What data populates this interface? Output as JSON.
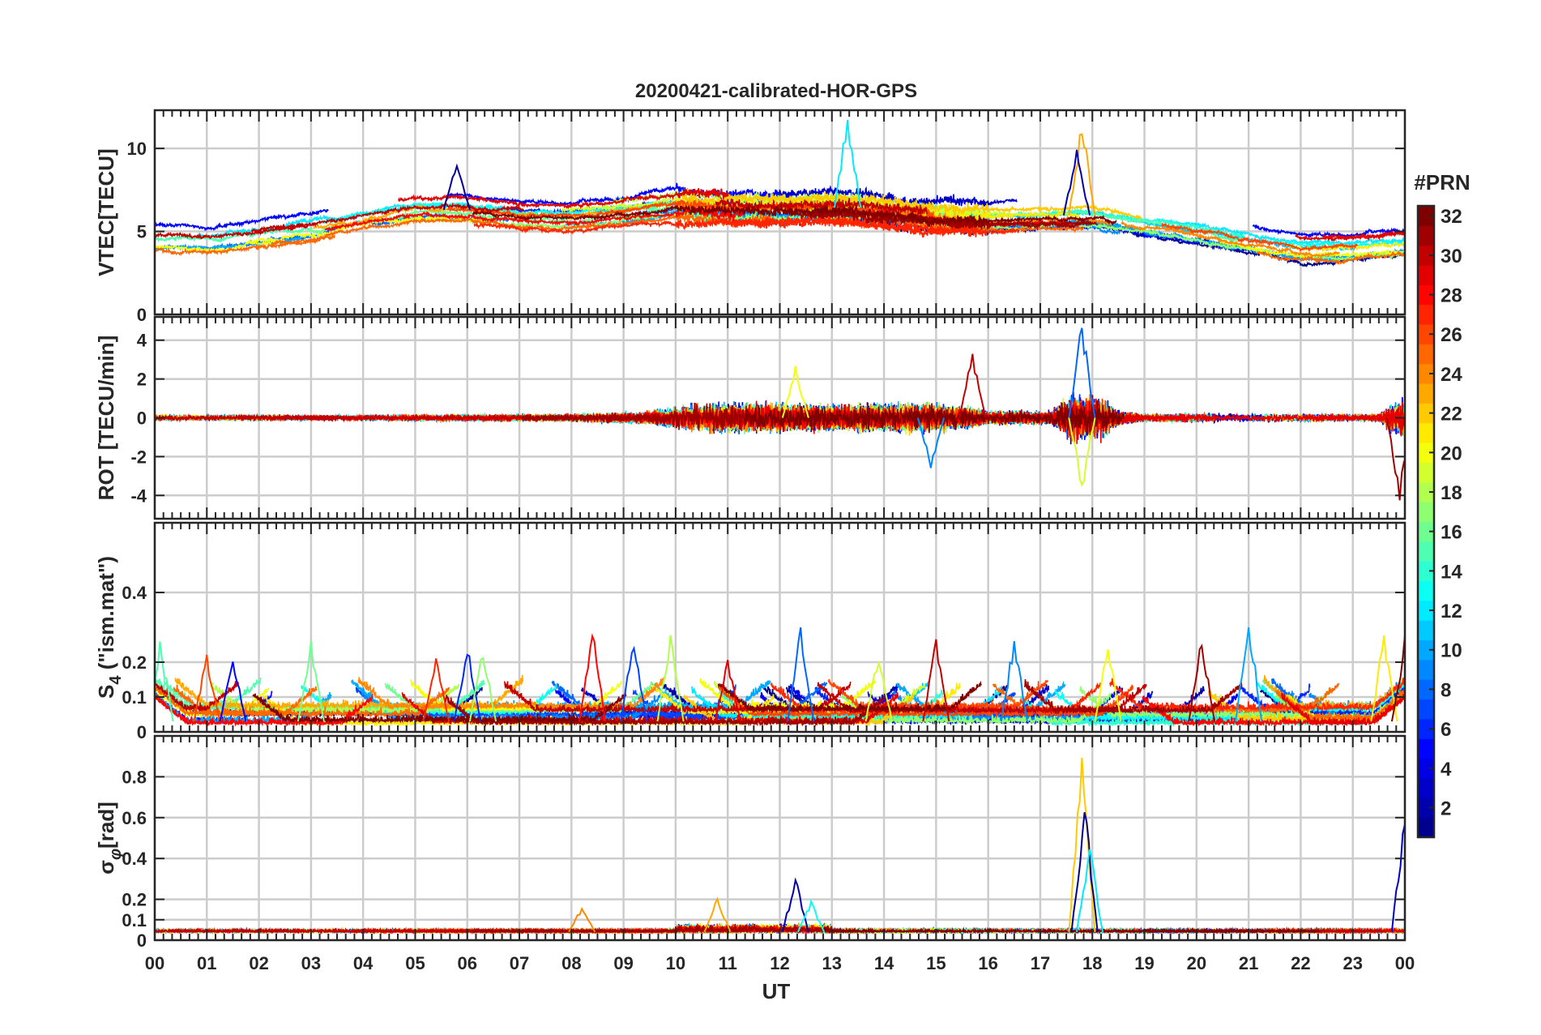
{
  "title": "20200421-calibrated-HOR-GPS",
  "xlabel": "UT",
  "colorbar": {
    "label": "#PRN",
    "range": [
      1,
      32
    ],
    "ticks": [
      2,
      4,
      6,
      8,
      10,
      12,
      14,
      16,
      18,
      20,
      22,
      24,
      26,
      28,
      30,
      32
    ],
    "colormap": "jet",
    "colors": [
      "#00008f",
      "#0000ff",
      "#0080ff",
      "#00ffff",
      "#80ff80",
      "#ffff00",
      "#ff8000",
      "#ff0000",
      "#800000"
    ]
  },
  "chart_data": [
    {
      "type": "line",
      "name": "vtec",
      "ylabel": "VTEC[TECU]",
      "xlim": [
        0,
        24
      ],
      "ylim": [
        0,
        12.3
      ],
      "yticks": [
        0,
        5,
        10
      ],
      "xticks": [
        0,
        1,
        2,
        3,
        4,
        5,
        6,
        7,
        8,
        9,
        10,
        11,
        12,
        13,
        14,
        15,
        16,
        17,
        18,
        19,
        20,
        21,
        22,
        23,
        24
      ],
      "grid": true,
      "series_count": 32,
      "envelope": [
        [
          0,
          4.5
        ],
        [
          1,
          4.4
        ],
        [
          2,
          4.8
        ],
        [
          3,
          5.2
        ],
        [
          4,
          5.8
        ],
        [
          5,
          6.3
        ],
        [
          6,
          6.3
        ],
        [
          7,
          6.0
        ],
        [
          8,
          5.9
        ],
        [
          9,
          6.2
        ],
        [
          10,
          6.6
        ],
        [
          11,
          6.4
        ],
        [
          12,
          6.4
        ],
        [
          13,
          6.5
        ],
        [
          14,
          6.3
        ],
        [
          15,
          6.0
        ],
        [
          16,
          5.8
        ],
        [
          17,
          5.9
        ],
        [
          18,
          6.0
        ],
        [
          19,
          5.5
        ],
        [
          20,
          5.0
        ],
        [
          21,
          4.5
        ],
        [
          22,
          4.0
        ],
        [
          23,
          4.0
        ],
        [
          24,
          4.3
        ]
      ],
      "features": [
        {
          "x": 5.8,
          "y": 9.6
        },
        {
          "x": 13.3,
          "y": 12.3
        },
        {
          "x": 17.8,
          "y": 12.0
        },
        {
          "x": 17.7,
          "y": 10.0
        }
      ]
    },
    {
      "type": "line",
      "name": "rot",
      "ylabel": "ROT [TECU/min]",
      "xlim": [
        0,
        24
      ],
      "ylim": [
        -5.2,
        5.2
      ],
      "yticks": [
        -4,
        -2,
        0,
        2,
        4
      ],
      "grid": true,
      "series_count": 32,
      "activity": [
        [
          0,
          0.3
        ],
        [
          3,
          0.3
        ],
        [
          8,
          0.4
        ],
        [
          9.5,
          0.7
        ],
        [
          10.5,
          1.5
        ],
        [
          12,
          1.5
        ],
        [
          13,
          1.3
        ],
        [
          14.5,
          1.5
        ],
        [
          15.5,
          1.2
        ],
        [
          16,
          0.7
        ],
        [
          17.2,
          0.7
        ],
        [
          17.6,
          2.5
        ],
        [
          18.2,
          2.0
        ],
        [
          18.5,
          0.8
        ],
        [
          19,
          0.4
        ],
        [
          20,
          0.5
        ],
        [
          21,
          0.4
        ],
        [
          23.5,
          0.4
        ],
        [
          24,
          2.5
        ]
      ],
      "features": [
        {
          "x": 17.8,
          "y": 5.2
        },
        {
          "x": 17.8,
          "y": -3.9
        },
        {
          "x": 15.7,
          "y": 3.5
        },
        {
          "x": 14.9,
          "y": -2.8
        },
        {
          "x": 12.3,
          "y": 2.8
        },
        {
          "x": 23.9,
          "y": -4.5
        }
      ]
    },
    {
      "type": "line",
      "name": "s4",
      "ylabel": "S4 (\"ism.mat\")",
      "ylabel_main": "S",
      "ylabel_sub": "4",
      "ylabel_rest": " (\"ism.mat\")",
      "xlim": [
        0,
        24
      ],
      "ylim": [
        0,
        0.6
      ],
      "yticks": [
        0,
        0.1,
        0.2,
        0.4
      ],
      "ytick_labels": [
        "0",
        "0.1",
        "0.2",
        "0.4"
      ],
      "grid": true,
      "series_count": 32,
      "features": [
        {
          "x": 0.1,
          "y": 0.28
        },
        {
          "x": 1.0,
          "y": 0.24
        },
        {
          "x": 1.5,
          "y": 0.22
        },
        {
          "x": 3.0,
          "y": 0.27
        },
        {
          "x": 5.4,
          "y": 0.22
        },
        {
          "x": 6.0,
          "y": 0.26
        },
        {
          "x": 6.3,
          "y": 0.25
        },
        {
          "x": 8.4,
          "y": 0.31
        },
        {
          "x": 9.2,
          "y": 0.29
        },
        {
          "x": 9.9,
          "y": 0.3
        },
        {
          "x": 11.0,
          "y": 0.21
        },
        {
          "x": 12.4,
          "y": 0.31
        },
        {
          "x": 13.9,
          "y": 0.25
        },
        {
          "x": 15.0,
          "y": 0.28
        },
        {
          "x": 16.5,
          "y": 0.29
        },
        {
          "x": 18.3,
          "y": 0.28
        },
        {
          "x": 20.1,
          "y": 0.28
        },
        {
          "x": 21.0,
          "y": 0.35
        },
        {
          "x": 23.6,
          "y": 0.3
        },
        {
          "x": 24.0,
          "y": 0.28
        }
      ]
    },
    {
      "type": "line",
      "name": "sigma_phi",
      "ylabel": "σφ[rad]",
      "ylabel_main": "σ",
      "ylabel_sub": "φ",
      "ylabel_rest": "[rad]",
      "xlim": [
        0,
        24
      ],
      "ylim": [
        0,
        1.0
      ],
      "yticks": [
        0,
        0.1,
        0.2,
        0.4,
        0.6,
        0.8
      ],
      "ytick_labels": [
        "0",
        "0.1",
        "0.2",
        "0.4",
        "0.6",
        "0.8"
      ],
      "grid": true,
      "series_count": 32,
      "features": [
        {
          "x": 17.8,
          "y": 1.0
        },
        {
          "x": 17.85,
          "y": 0.7
        },
        {
          "x": 17.95,
          "y": 0.48
        },
        {
          "x": 10.8,
          "y": 0.22
        },
        {
          "x": 12.3,
          "y": 0.32
        },
        {
          "x": 12.6,
          "y": 0.2
        },
        {
          "x": 8.2,
          "y": 0.17
        },
        {
          "x": 24.0,
          "y": 0.68
        }
      ]
    }
  ]
}
